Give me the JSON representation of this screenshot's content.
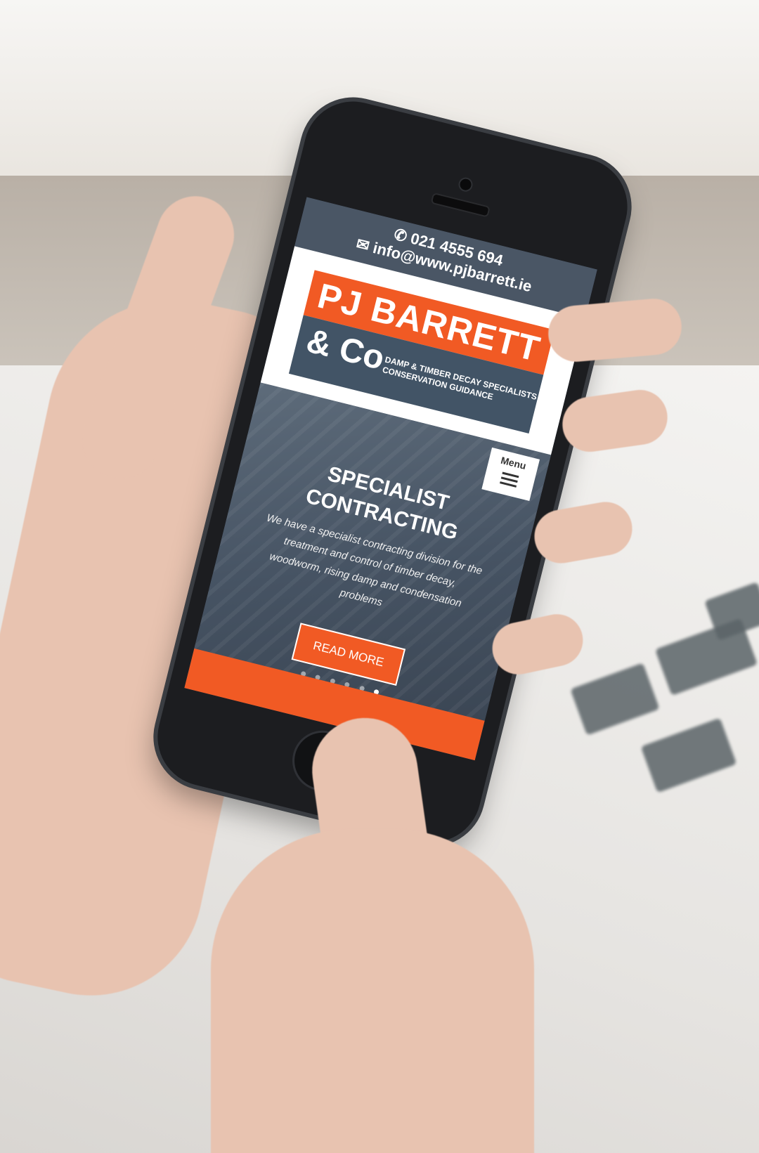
{
  "site": {
    "phone": "021 4555 694",
    "email": "info@www.pjbarrett.ie",
    "logo": {
      "line1": "PJ BARRETT",
      "line2": "& Co",
      "tagline1": "DAMP & TIMBER DECAY SPECIALISTS",
      "tagline2": "CONSERVATION GUIDANCE"
    },
    "menu_label": "Menu"
  },
  "hero": {
    "title_line1": "SPECIALIST",
    "title_line2": "CONTRACTING",
    "text": "We have a specialist contracting division for the treatment and control of timber decay, woodworm, rising damp and condensation problems",
    "button_label": "READ MORE",
    "slides_total": 6,
    "active_slide": 6
  },
  "colors": {
    "brand_orange": "#f15a24",
    "brand_slate": "#425466",
    "topbar": "#4a5665"
  },
  "icons": [
    "phone-icon",
    "mail-icon",
    "hamburger-menu-icon"
  ]
}
